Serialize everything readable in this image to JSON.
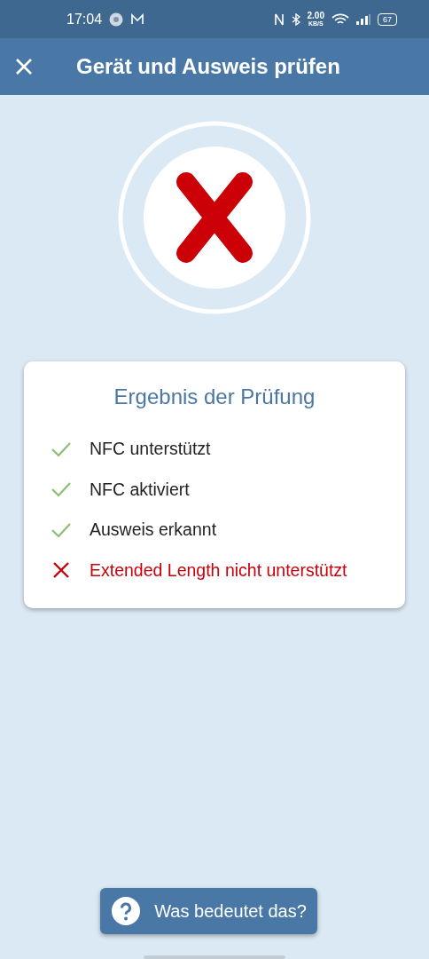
{
  "status_bar": {
    "time": "17:04",
    "net_speed": "2.00",
    "net_unit": "KB/S",
    "battery": "67"
  },
  "header": {
    "title": "Gerät und Ausweis prüfen"
  },
  "result": {
    "passed": false
  },
  "card": {
    "title": "Ergebnis der Prüfung",
    "checks": [
      {
        "label": "NFC unterstützt",
        "passed": true
      },
      {
        "label": "NFC aktiviert",
        "passed": true
      },
      {
        "label": "Ausweis erkannt",
        "passed": true
      },
      {
        "label": "Extended Length nicht unterstützt",
        "passed": false
      }
    ]
  },
  "help_button": {
    "label": "Was bedeutet das?"
  }
}
